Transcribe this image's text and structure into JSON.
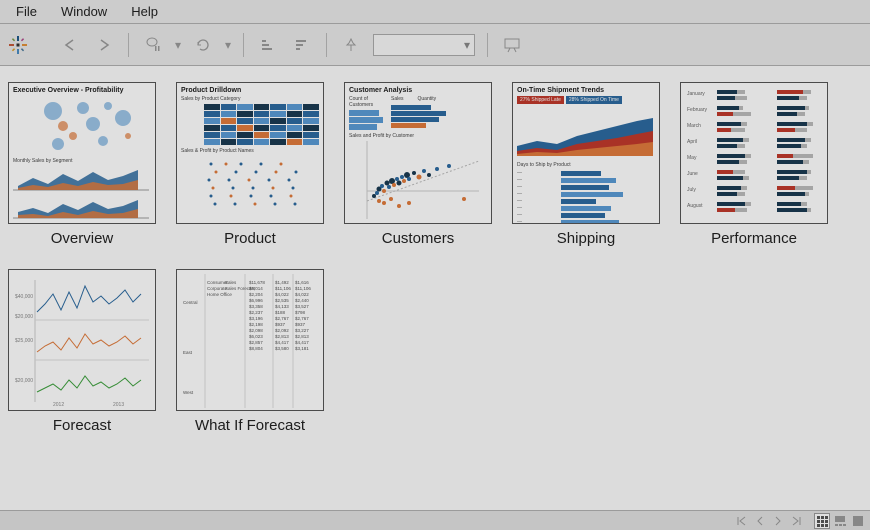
{
  "menu": {
    "items": [
      "File",
      "Window",
      "Help"
    ]
  },
  "toolbar": {
    "buttons": [
      "back",
      "forward",
      "pause",
      "refresh",
      "sort-asc",
      "sort-desc",
      "pin"
    ],
    "dropdown_value": "",
    "presentation": "Presentation"
  },
  "sheets": [
    {
      "label": "Overview",
      "title": "Executive Overview - Profitability"
    },
    {
      "label": "Product",
      "title": "Product Drilldown"
    },
    {
      "label": "Customers",
      "title": "Customer Analysis"
    },
    {
      "label": "Shipping",
      "title": "On-Time Shipment Trends"
    },
    {
      "label": "Performance",
      "title": ""
    },
    {
      "label": "Forecast",
      "title": ""
    },
    {
      "label": "What If Forecast",
      "title": ""
    }
  ],
  "shipping_badges": {
    "late": "27% Shipped Late",
    "ontime": "28% Shipped On Time"
  },
  "colors": {
    "accent_blue": "#2c6aa0",
    "accent_blue_light": "#5a9bd4",
    "accent_orange": "#e07b3c",
    "accent_red": "#c0392b",
    "accent_green": "#3fa03f",
    "accent_dark": "#1a3a52"
  },
  "status_bar": {
    "nav": [
      "first",
      "prev",
      "next",
      "last"
    ],
    "views": [
      "grid",
      "filmstrip",
      "single"
    ],
    "active_view": "grid"
  }
}
